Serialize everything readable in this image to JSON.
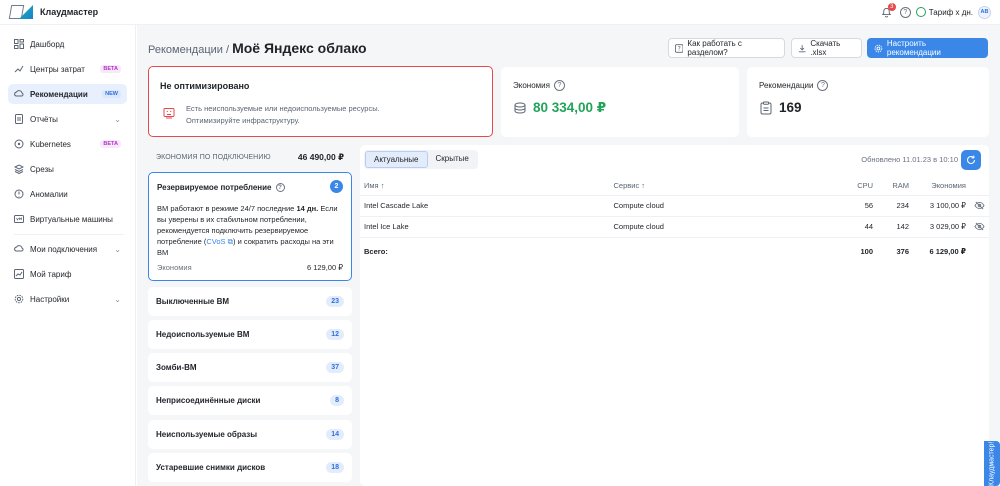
{
  "app": {
    "name": "Клаудмастер"
  },
  "topbar": {
    "notifications_count": "3",
    "help": "?",
    "tariff": "Тариф х дн.",
    "avatar": "АВ"
  },
  "sidebar": {
    "items": [
      {
        "label": "Дашборд",
        "icon": "dashboard-icon"
      },
      {
        "label": "Центры затрат",
        "icon": "cost-centers-icon",
        "tag": "BETA"
      },
      {
        "label": "Рекомендации",
        "icon": "recommendations-icon",
        "tag": "NEW"
      },
      {
        "label": "Отчёты",
        "icon": "reports-icon"
      },
      {
        "label": "Kubernetes",
        "icon": "kubernetes-icon",
        "tag": "BETA"
      },
      {
        "label": "Срезы",
        "icon": "slices-icon"
      },
      {
        "label": "Аномалии",
        "icon": "anomalies-icon"
      },
      {
        "label": "Виртуальные машины",
        "icon": "vm-icon"
      },
      {
        "label": "Мои подключения",
        "icon": "connections-icon"
      },
      {
        "label": "Мой тариф",
        "icon": "tariff-icon"
      },
      {
        "label": "Настройки",
        "icon": "settings-icon"
      }
    ]
  },
  "header": {
    "breadcrumb_parent": "Рекомендации /",
    "title": "Моё Яндекс облако",
    "help_button": "Как работать с разделом?",
    "download_button": "Скачать .xlsx",
    "configure_button": "Настроить рекомендации"
  },
  "status_card": {
    "title": "Не оптимизировано",
    "line1": "Есть неиспользуемые или недоиспользуемые ресурсы.",
    "line2": "Оптимизируйте инфраструктуру."
  },
  "economy_card": {
    "label": "Экономия",
    "value": "80 334,00 ₽",
    "color": "#22a35a"
  },
  "recs_card": {
    "label": "Рекомендации",
    "value": "169"
  },
  "connection_economy": {
    "label": "Экономия по подключению",
    "value": "46 490,00 ₽"
  },
  "reserved": {
    "title": "Резервируемое потребление",
    "count": "2",
    "text1": "ВМ работают в режиме 24/7 последние ",
    "days": "14 дн.",
    "text2": " Если вы уверены в их стабильном потреблении, рекомендуется подключить резервируемое потребление (",
    "link": "CVoS",
    "text3": ") и сократить расходы на эти ВМ",
    "economy_label": "Экономия",
    "economy_value": "6 129,00 ₽"
  },
  "categories": [
    {
      "name": "Выключенные ВМ",
      "count": "23"
    },
    {
      "name": "Недоиспользуемые ВМ",
      "count": "12"
    },
    {
      "name": "Зомби-ВМ",
      "count": "37"
    },
    {
      "name": "Неприсоединённые диски",
      "count": "8"
    },
    {
      "name": "Неиспользуемые образы",
      "count": "14"
    },
    {
      "name": "Устаревшие снимки дисков",
      "count": "18"
    }
  ],
  "table": {
    "tabs": [
      "Актуальные",
      "Скрытые"
    ],
    "updated": "Обновлено 11.01.23 в 10:10",
    "columns": {
      "name": "Имя",
      "service": "Сервис",
      "cpu": "CPU",
      "ram": "RAM",
      "economy": "Экономия"
    },
    "rows": [
      {
        "name": "Intel Cascade Lake",
        "service": "Compute cloud",
        "cpu": "56",
        "ram": "234",
        "economy": "3 100,00 ₽"
      },
      {
        "name": "Intel Ice Lake",
        "service": "Compute cloud",
        "cpu": "44",
        "ram": "142",
        "economy": "3 029,00 ₽"
      }
    ],
    "total": {
      "label": "Всего:",
      "cpu": "100",
      "ram": "376",
      "economy": "6 129,00 ₽"
    }
  },
  "feedback_tab": "Клаудмастер!"
}
